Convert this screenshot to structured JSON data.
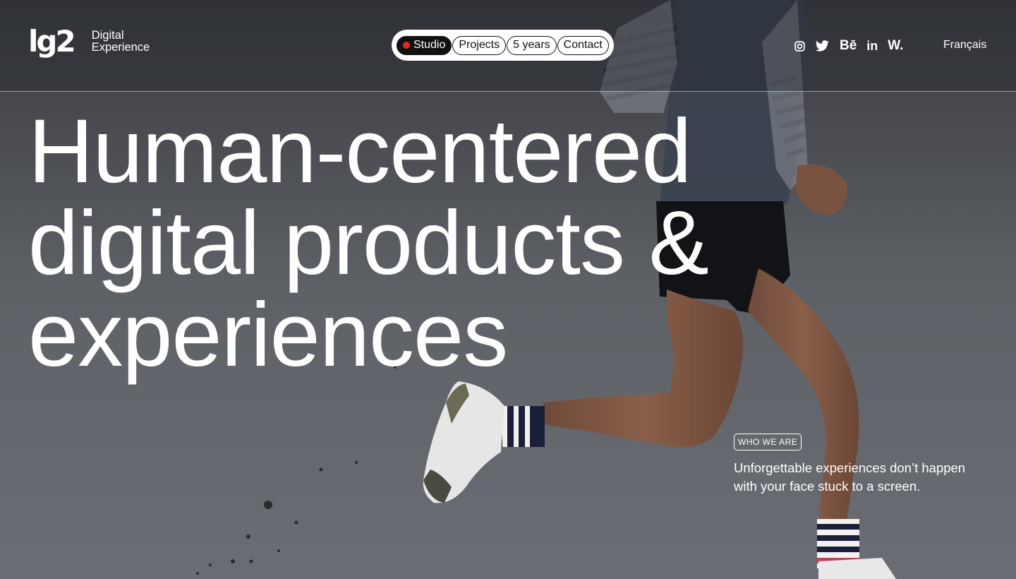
{
  "brand": {
    "logo_text": "lg2",
    "subtitle_line1": "Digital",
    "subtitle_line2": "Experience"
  },
  "nav": {
    "items": [
      {
        "label": "Studio",
        "active": true
      },
      {
        "label": "Projects",
        "active": false
      },
      {
        "label": "5 years",
        "active": false
      },
      {
        "label": "Contact",
        "active": false
      }
    ]
  },
  "social": [
    {
      "name": "instagram-icon"
    },
    {
      "name": "twitter-icon"
    },
    {
      "name": "behance-icon",
      "glyph": "Bē"
    },
    {
      "name": "linkedin-icon",
      "glyph": "in"
    },
    {
      "name": "awwwards-icon",
      "glyph": "W."
    }
  ],
  "language": {
    "label": "Français"
  },
  "hero": {
    "headline_line1": "Human-centered",
    "headline_line2": "digital products &",
    "headline_line3": "experiences"
  },
  "about": {
    "tag": "WHO WE ARE",
    "text": "Unforgettable experiences don’t happen with your face stuck to a screen."
  },
  "colors": {
    "accent_dot": "#e8261a",
    "nav_bg": "#ffffff",
    "text": "#ffffff"
  }
}
